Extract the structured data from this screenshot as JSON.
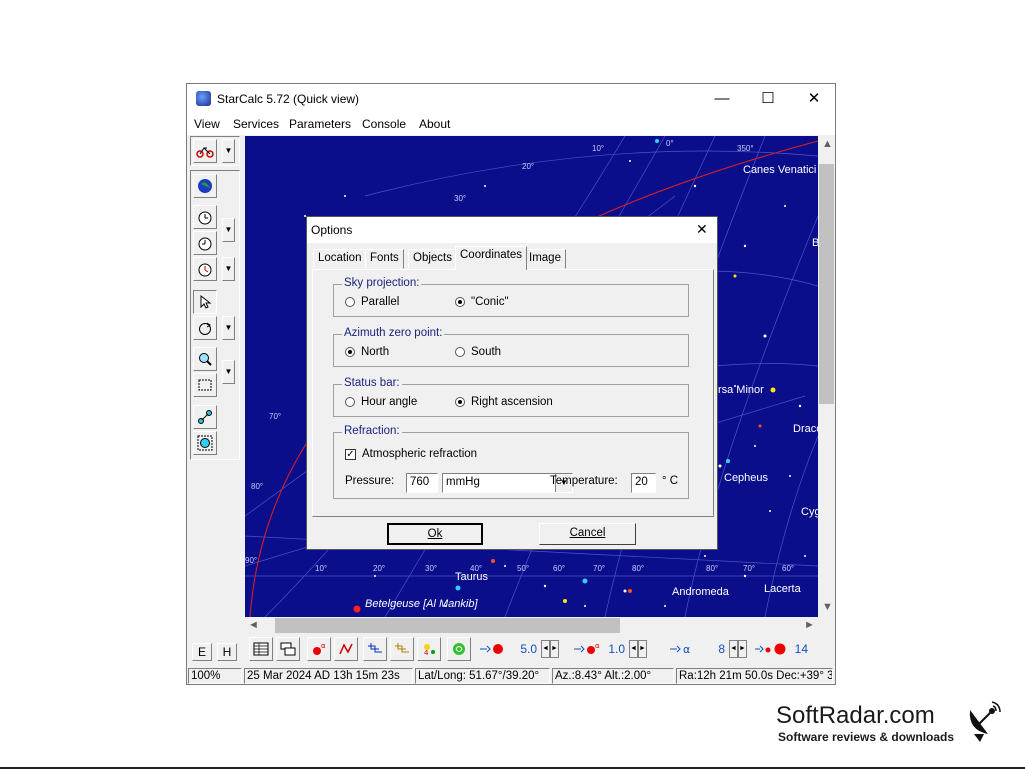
{
  "window": {
    "title": "StarCalc 5.72 (Quick view)",
    "controls": {
      "minimize": "—",
      "maximize": "☐",
      "close": "✕"
    }
  },
  "menu": [
    "View",
    "Services",
    "Parameters",
    "Console",
    "About"
  ],
  "sky": {
    "labels": [
      "Canes Venatici",
      "B",
      "Ursa Minor",
      "Draco",
      "Cepheus",
      "Cygnus",
      "Taurus",
      "Andromeda",
      "Lacerta",
      "Betelgeuse [Al Mankib]"
    ],
    "degree_marks": [
      "10°",
      "0°",
      "350°",
      "20°",
      "30°",
      "70°",
      "80°",
      "90°",
      "10°",
      "20°",
      "30°",
      "40°",
      "50°",
      "60°",
      "70°",
      "80°",
      "70°",
      "80°",
      "60°"
    ]
  },
  "scroll": {
    "up": "▲",
    "down": "▼",
    "left": "◄",
    "right": "►"
  },
  "bottom_toolbar": {
    "e_label": "E",
    "h_label": "H",
    "spin1_value": "5.0",
    "spin2_value": "1.0",
    "spin3_value": "8",
    "spin4_value": "14"
  },
  "status": {
    "zoom": "100%",
    "datetime": "25 Mar 2024 AD 13h 15m 23s",
    "latlong": "Lat/Long: 51.67°/39.20°",
    "azalt": "Az.:8.43° Alt.:2.00°",
    "radec": "Ra:12h 21m 50.0s Dec:+39° 3"
  },
  "dialog": {
    "title": "Options",
    "close": "✕",
    "tabs": [
      "Location",
      "Fonts",
      "Objects",
      "Coordinates",
      "Image"
    ],
    "sky_projection": {
      "title": "Sky projection:",
      "option1": "Parallel",
      "option2": "\"Conic\""
    },
    "azimuth": {
      "title": "Azimuth zero point:",
      "option1": "North",
      "option2": "South"
    },
    "status_bar": {
      "title": "Status bar:",
      "option1": "Hour angle",
      "option2": "Right ascension"
    },
    "refraction": {
      "title": "Refraction:",
      "checkbox_label": "Atmospheric refraction",
      "pressure_label": "Pressure:",
      "pressure_value": "760",
      "unit_value": "mmHg",
      "temperature_label": "Temperature:",
      "temperature_value": "20",
      "temperature_unit": "° C"
    },
    "ok": "Ok",
    "cancel": "Cancel"
  },
  "watermark": {
    "brand": "SoftRadar.com",
    "tagline": "Software reviews & downloads"
  }
}
